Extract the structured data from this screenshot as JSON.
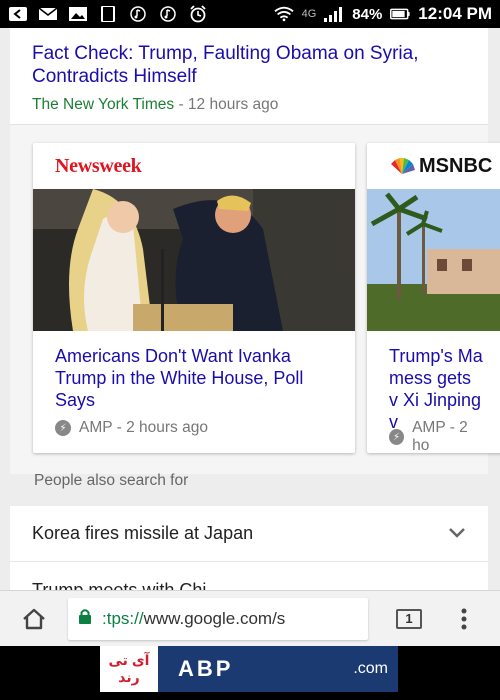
{
  "status_bar": {
    "network": "4G",
    "battery": "84%",
    "time": "12:04 PM"
  },
  "top_story": {
    "title": "Fact Check: Trump, Faulting Obama on Syria, Contradicts Himself",
    "source": "The New York Times",
    "time": " - 12 hours ago"
  },
  "news_cards": [
    {
      "publisher": "Newsweek",
      "headline": "Americans Don't Want Ivanka Trump in the White House, Poll Says",
      "meta": "AMP - 2 hours ago"
    },
    {
      "publisher": "MSNBC",
      "headline": "Trump's Ma mess gets v Xi Jinping v",
      "meta": "AMP - 2 ho"
    }
  ],
  "people_also_search": {
    "label": "People also search for",
    "items": [
      "Korea fires missile at Japan",
      "Trump meets with Chi"
    ]
  },
  "browser": {
    "url_prefix": ":tps://",
    "url_main": "www.google.com/s",
    "tab_count": "1"
  },
  "ad": {
    "persian_text": "آی تی رند",
    "logo": "ABP",
    "suffix": ".com"
  },
  "colors": {
    "link_blue": "#1a0dab",
    "source_green": "#1e7e34",
    "newsweek_red": "#e0141e"
  }
}
